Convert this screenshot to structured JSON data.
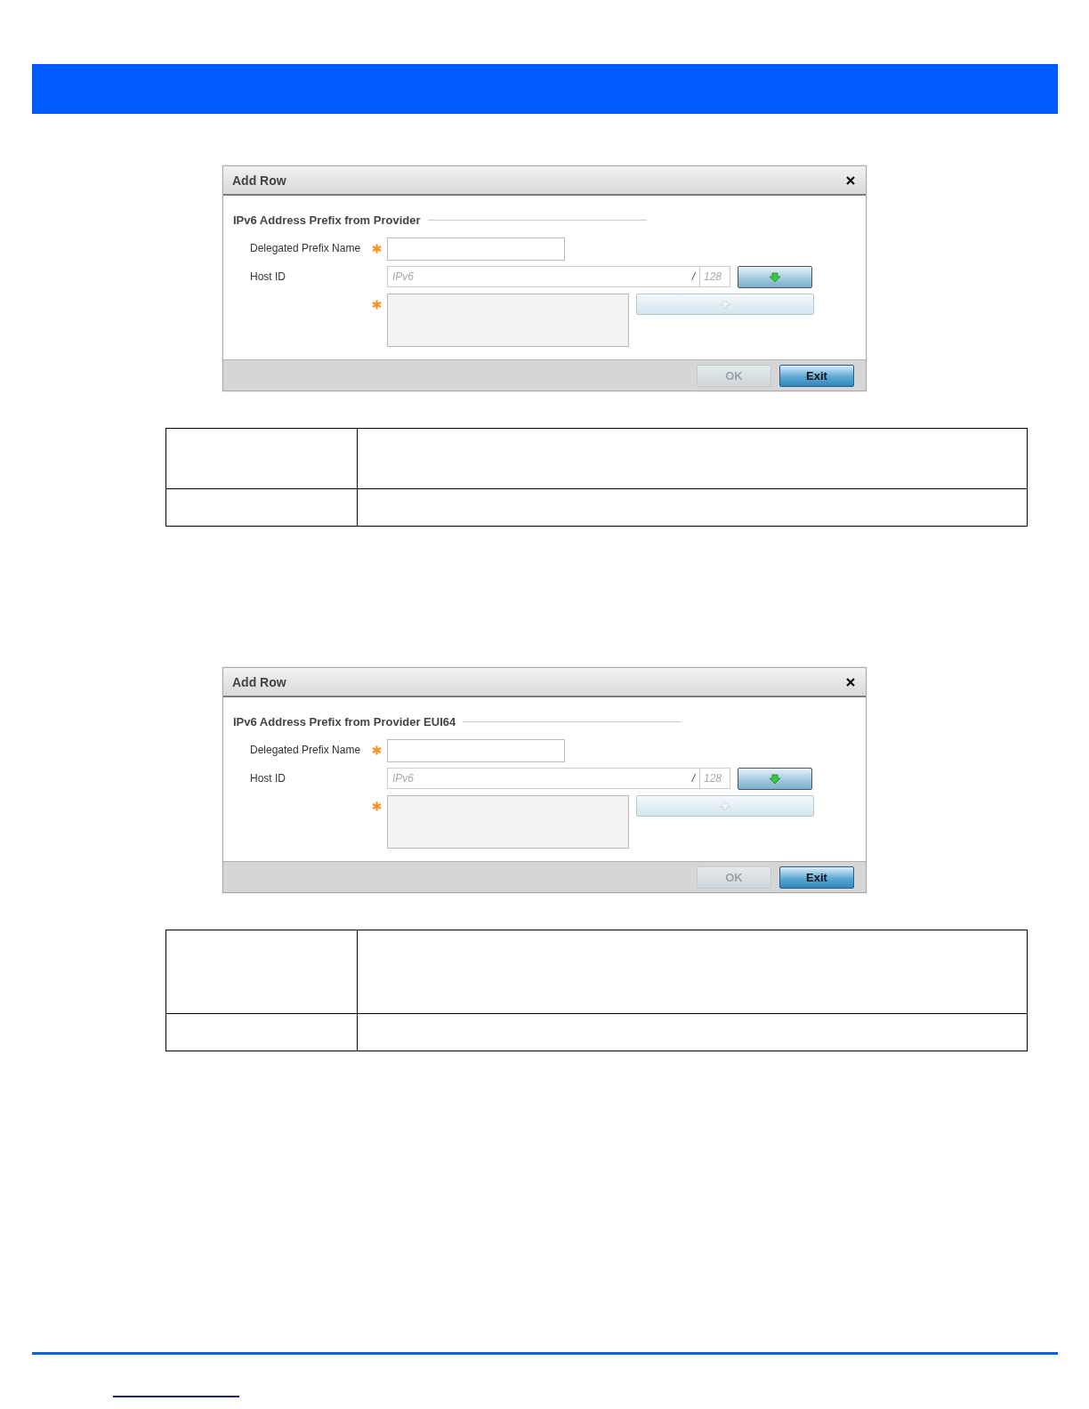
{
  "dialogs": [
    {
      "title": "Add Row",
      "section": "IPv6 Address Prefix from Provider",
      "name_field": {
        "label": "Delegated Prefix Name",
        "required": true
      },
      "host_field": {
        "label": "Host ID",
        "placeholder": "IPv6",
        "separator": "/",
        "prefix_length_placeholder": "128"
      },
      "list_required": true,
      "buttons": [
        {
          "label": "OK",
          "disabled": true
        },
        {
          "label": "Exit",
          "disabled": false
        }
      ]
    },
    {
      "title": "Add Row",
      "section": "IPv6 Address Prefix from Provider EUI64",
      "name_field": {
        "label": "Delegated Prefix Name",
        "required": true
      },
      "host_field": {
        "label": "Host ID",
        "placeholder": "IPv6",
        "separator": "/",
        "prefix_length_placeholder": "128"
      },
      "list_required": true,
      "buttons": [
        {
          "label": "OK",
          "disabled": true
        },
        {
          "label": "Exit",
          "disabled": false
        }
      ]
    }
  ]
}
